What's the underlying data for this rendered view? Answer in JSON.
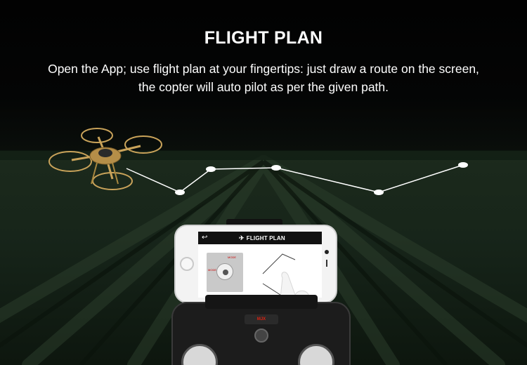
{
  "header": {
    "title": "FLIGHT PLAN",
    "line1": "Open the App; use flight plan at your fingertips: just draw a route on the screen,",
    "line2": "the copter will auto pilot as per the given path."
  },
  "phone_app": {
    "back_icon": "back-arrow-icon",
    "title": "FLIGHT PLAN",
    "mode_label_top": "MODE",
    "mode_label_left": "MODE"
  },
  "controller": {
    "brand": "MJX"
  },
  "colors": {
    "route_line": "#ffffff",
    "drone_body": "#c9a35a",
    "accent_red": "#cc1111"
  }
}
